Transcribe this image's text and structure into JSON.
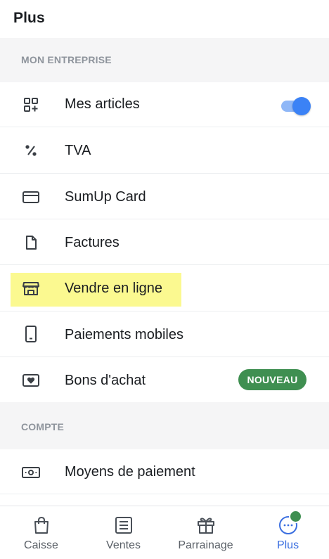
{
  "header": {
    "title": "Plus"
  },
  "sections": [
    {
      "label": "MON ENTREPRISE",
      "items": [
        {
          "label": "Mes articles",
          "icon": "grid-add-icon",
          "toggle": true
        },
        {
          "label": "TVA",
          "icon": "percent-icon"
        },
        {
          "label": "SumUp Card",
          "icon": "credit-card-icon"
        },
        {
          "label": "Factures",
          "icon": "document-icon"
        },
        {
          "label": "Vendre en ligne",
          "icon": "storefront-icon",
          "highlighted": true
        },
        {
          "label": "Paiements mobiles",
          "icon": "smartphone-icon"
        },
        {
          "label": "Bons d'achat",
          "icon": "gift-card-icon",
          "badge": "NOUVEAU"
        }
      ]
    },
    {
      "label": "COMPTE",
      "items": [
        {
          "label": "Moyens de paiement",
          "icon": "banknote-icon"
        }
      ]
    }
  ],
  "bottom_nav": [
    {
      "label": "Caisse",
      "icon": "shopping-bag-icon",
      "active": false
    },
    {
      "label": "Ventes",
      "icon": "receipt-list-icon",
      "active": false
    },
    {
      "label": "Parrainage",
      "icon": "gift-icon",
      "active": false
    },
    {
      "label": "Plus",
      "icon": "more-horizontal-icon",
      "active": true,
      "notification": true
    }
  ],
  "colors": {
    "accent_blue": "#3b82f6",
    "active_nav": "#3b6fe0",
    "badge_green": "#3f8f51",
    "highlight_yellow": "#fbf990",
    "section_bg": "#f5f5f6",
    "section_text": "#8e949c"
  },
  "toggle_state": {
    "mes_articles": "on"
  }
}
